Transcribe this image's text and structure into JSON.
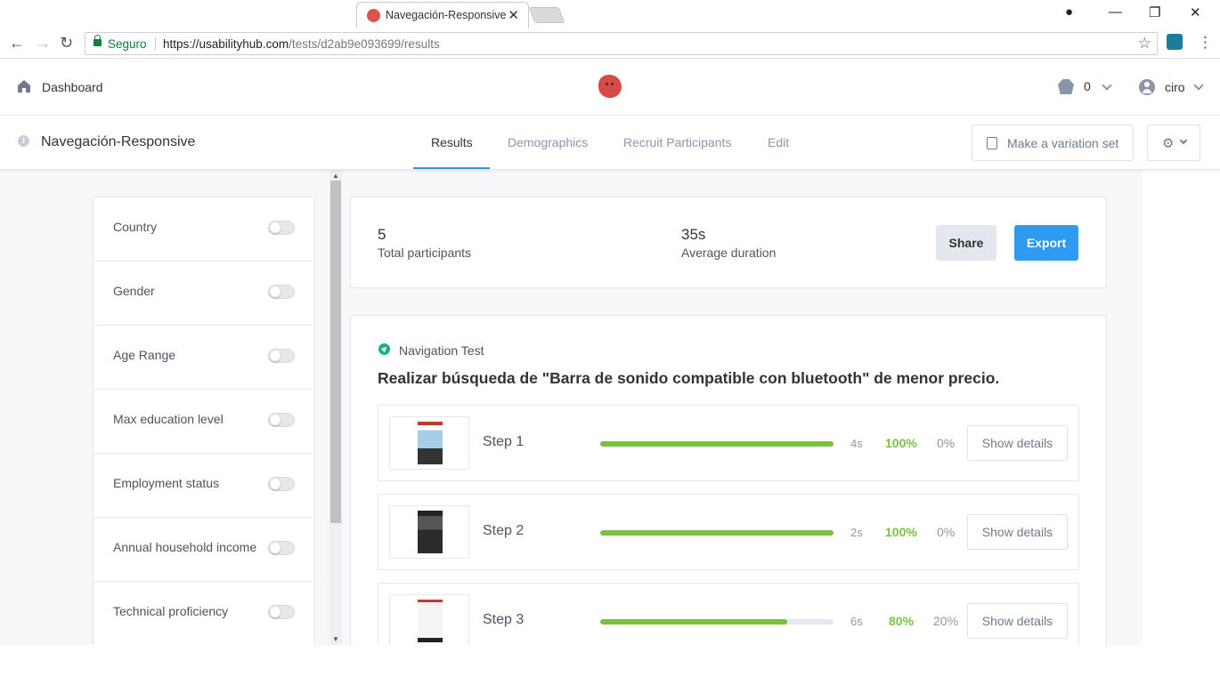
{
  "browser": {
    "tab_title": "Navegación-Responsive",
    "secure_label": "Seguro",
    "url_host": "https://usabilityhub.com",
    "url_path": "/tests/d2ab9e093699/results"
  },
  "header": {
    "dashboard_label": "Dashboard",
    "credits": "0",
    "user_name": "ciro"
  },
  "test": {
    "title": "Navegación-Responsive",
    "tabs": [
      "Results",
      "Demographics",
      "Recruit Participants",
      "Edit"
    ],
    "active_tab": "Results",
    "variation_button": "Make a variation set"
  },
  "filters": [
    "Country",
    "Gender",
    "Age Range",
    "Max education level",
    "Employment status",
    "Annual household income",
    "Technical proficiency"
  ],
  "summary": {
    "participants_value": "5",
    "participants_label": "Total participants",
    "duration_value": "35s",
    "duration_label": "Average duration",
    "share_label": "Share",
    "export_label": "Export"
  },
  "results": {
    "test_type": "Navigation Test",
    "task": "Realizar búsqueda de \"Barra de sonido compatible con bluetooth\" de menor precio.",
    "steps": [
      {
        "name": "Step 1",
        "time": "4s",
        "success": "100%",
        "fail": "0%",
        "success_ratio": 1.0,
        "details": "Show details"
      },
      {
        "name": "Step 2",
        "time": "2s",
        "success": "100%",
        "fail": "0%",
        "success_ratio": 1.0,
        "details": "Show details"
      },
      {
        "name": "Step 3",
        "time": "6s",
        "success": "80%",
        "fail": "20%",
        "success_ratio": 0.8,
        "details": "Show details"
      }
    ]
  },
  "colors": {
    "accent": "#2f9bf0",
    "success": "#7ac143",
    "brand": "#d84b44"
  }
}
